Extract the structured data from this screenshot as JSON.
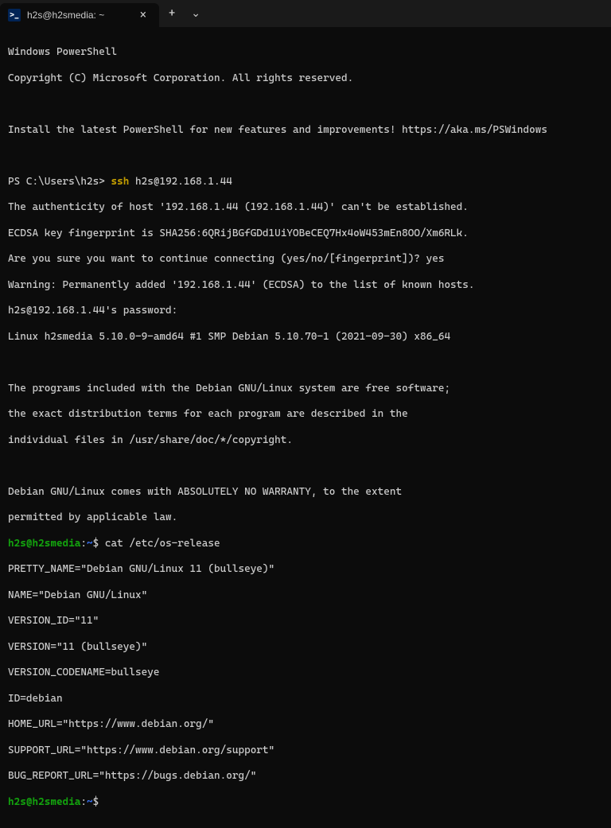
{
  "titlebar": {
    "tab_title": "h2s@h2smedia: ~",
    "tab_icon_text": ">_",
    "close_glyph": "×",
    "add_glyph": "+",
    "dropdown_glyph": "⌄"
  },
  "terminal": {
    "header1": "Windows PowerShell",
    "header2": "Copyright (C) Microsoft Corporation. All rights reserved.",
    "install_msg": "Install the latest PowerShell for new features and improvements! https://aka.ms/PSWindows",
    "ps_prompt": "PS C:\\Users\\h2s> ",
    "ssh_cmd": "ssh",
    "ssh_target": " h2s@192.168.1.44",
    "auth1": "The authenticity of host '192.168.1.44 (192.168.1.44)' can't be established.",
    "auth2": "ECDSA key fingerprint is SHA256:6QRijBGfGDd1UiYOBeCEQ7Hx4oW453mEn8OO/Xm6RLk.",
    "auth3": "Are you sure you want to continue connecting (yes/no/[fingerprint])? yes",
    "auth4": "Warning: Permanently added '192.168.1.44' (ECDSA) to the list of known hosts.",
    "auth5": "h2s@192.168.1.44's password:",
    "linux_line": "Linux h2smedia 5.10.0-9-amd64 #1 SMP Debian 5.10.70-1 (2021-09-30) x86_64",
    "motd1": "The programs included with the Debian GNU/Linux system are free software;",
    "motd2": "the exact distribution terms for each program are described in the",
    "motd3": "individual files in /usr/share/doc/*/copyright.",
    "motd4": "Debian GNU/Linux comes with ABSOLUTELY NO WARRANTY, to the extent",
    "motd5": "permitted by applicable law.",
    "bash_prompt_userhost": "h2s@h2smedia",
    "bash_prompt_sep": ":",
    "bash_prompt_path": "~",
    "bash_prompt_end": "$ ",
    "cat_cmd": "cat /etc/os-release",
    "os1": "PRETTY_NAME=\"Debian GNU/Linux 11 (bullseye)\"",
    "os2": "NAME=\"Debian GNU/Linux\"",
    "os3": "VERSION_ID=\"11\"",
    "os4": "VERSION=\"11 (bullseye)\"",
    "os5": "VERSION_CODENAME=bullseye",
    "os6": "ID=debian",
    "os7": "HOME_URL=\"https://www.debian.org/\"",
    "os8": "SUPPORT_URL=\"https://www.debian.org/support\"",
    "os9": "BUG_REPORT_URL=\"https://bugs.debian.org/\""
  }
}
